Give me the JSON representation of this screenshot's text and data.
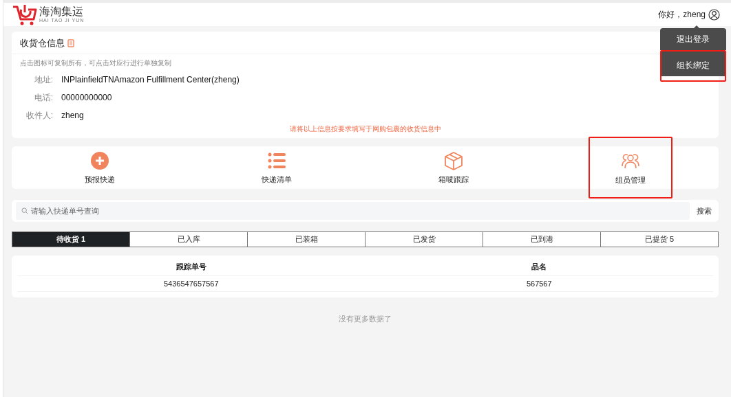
{
  "header": {
    "logo_title": "海淘集运",
    "logo_subtitle": "HAI TAO JI YUN",
    "greeting": "你好，zheng"
  },
  "user_menu": [
    {
      "label": "退出登录",
      "highlighted": false
    },
    {
      "label": "组长绑定",
      "highlighted": true
    }
  ],
  "warehouse_card": {
    "title": "收货仓信息",
    "hint": "点击图标可复制所有，可点击对应行进行单独复制",
    "fields": [
      {
        "label": "地址:",
        "value": "INPlainfieldTNAmazon Fulfillment Center(zheng)"
      },
      {
        "label": "电话:",
        "value": "00000000000"
      },
      {
        "label": "收件人:",
        "value": "zheng"
      }
    ],
    "notice": "请将以上信息按要求填写于网购包裹的收货信息中"
  },
  "actions": [
    {
      "kind": "plus",
      "label": "预报快递",
      "highlighted": false
    },
    {
      "kind": "list",
      "label": "快递清单",
      "highlighted": false
    },
    {
      "kind": "box",
      "label": "箱唛跟踪",
      "highlighted": false
    },
    {
      "kind": "people",
      "label": "组员管理",
      "highlighted": true
    }
  ],
  "search": {
    "placeholder": "请输入快递单号查询",
    "button": "搜索"
  },
  "status_tabs": [
    {
      "label": "待收货 1",
      "selected": true
    },
    {
      "label": "已入库",
      "selected": false
    },
    {
      "label": "已装箱",
      "selected": false
    },
    {
      "label": "已发货",
      "selected": false
    },
    {
      "label": "已到港",
      "selected": false
    },
    {
      "label": "已提货 5",
      "selected": false
    }
  ],
  "table": {
    "columns": [
      "跟踪单号",
      "品名"
    ],
    "rows": [
      [
        "5436547657567",
        "567567"
      ]
    ]
  },
  "footer_text": "没有更多数据了"
}
